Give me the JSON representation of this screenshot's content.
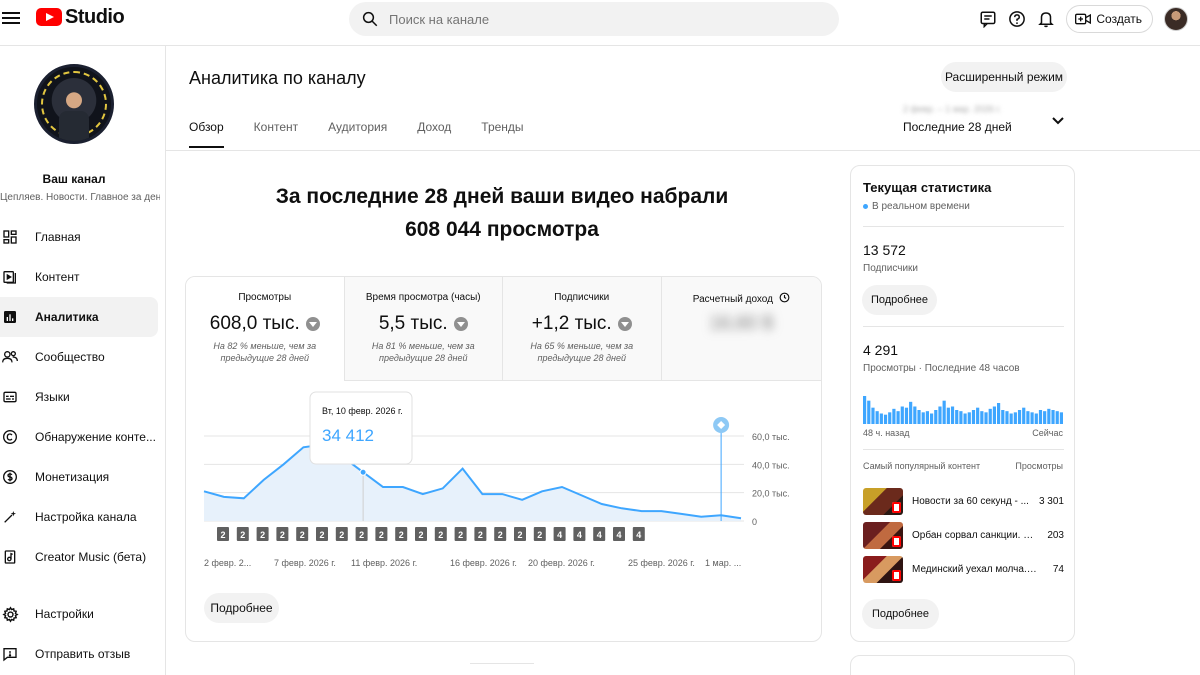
{
  "app": {
    "logo_text": "Studio",
    "search_placeholder": "Поиск на канале",
    "create_label": "Создать"
  },
  "sidebar": {
    "channel_name": "Ваш канал",
    "channel_desc": "Цепляев. Новости. Главное за день",
    "items": [
      {
        "label": "Главная",
        "icon": "dashboard-icon"
      },
      {
        "label": "Контент",
        "icon": "content-icon"
      },
      {
        "label": "Аналитика",
        "icon": "analytics-icon",
        "active": true
      },
      {
        "label": "Сообщество",
        "icon": "community-icon"
      },
      {
        "label": "Языки",
        "icon": "subtitles-icon"
      },
      {
        "label": "Обнаружение конте...",
        "icon": "copyright-icon"
      },
      {
        "label": "Монетизация",
        "icon": "monetization-icon"
      },
      {
        "label": "Настройка канала",
        "icon": "magic-wand-icon"
      },
      {
        "label": "Creator Music (бета)",
        "icon": "music-icon"
      }
    ],
    "bottom_items": [
      {
        "label": "Настройки",
        "icon": "settings-icon"
      },
      {
        "label": "Отправить отзыв",
        "icon": "feedback-icon"
      }
    ]
  },
  "main": {
    "title": "Аналитика по каналу",
    "advanced_label": "Расширенный режим",
    "tabs": [
      "Обзор",
      "Контент",
      "Аудитория",
      "Доход",
      "Тренды"
    ],
    "active_tab": "Обзор",
    "date_range": {
      "dates": "2 февр. – 1 мар. 2026 г.",
      "label": "Последние 28 дней"
    },
    "headline_line1": "За последние 28 дней ваши видео набрали",
    "headline_line2": "608 044 просмотра",
    "metrics": [
      {
        "label": "Просмотры",
        "value": "608,0 тыс.",
        "note": "На 82 % меньше, чем за предыдущие 28 дней",
        "trend": "down"
      },
      {
        "label": "Время просмотра (часы)",
        "value": "5,5 тыс.",
        "note": "На 81 % меньше, чем за предыдущие 28 дней",
        "trend": "down"
      },
      {
        "label": "Подписчики",
        "value": "+1,2 тыс.",
        "note": "На 65 % меньше, чем за предыдущие 28 дней",
        "trend": "down"
      },
      {
        "label": "Расчетный доход",
        "value": "16,60 $",
        "note": "",
        "trend": "hidden"
      }
    ],
    "more_label": "Подробнее"
  },
  "chart_data": {
    "type": "area",
    "title": "",
    "xlabel": "",
    "ylabel": "",
    "y_ticks": [
      "60,0 тыс.",
      "40,0 тыс.",
      "20,0 тыс.",
      "0"
    ],
    "ylim": [
      0,
      60000
    ],
    "x_tick_labels": [
      "2 февр. 2...",
      "7 февр. 2026 г.",
      "11 февр. 2026 г.",
      "16 февр. 2026 г.",
      "20 февр. 2026 г.",
      "25 февр. 2026 г.",
      "1 мар. ..."
    ],
    "x": [
      "2 февр.",
      "3 февр.",
      "4 февр.",
      "5 февр.",
      "6 февр.",
      "7 февр.",
      "8 февр.",
      "9 февр.",
      "10 февр.",
      "11 февр.",
      "12 февр.",
      "13 февр.",
      "14 февр.",
      "15 февр.",
      "16 февр.",
      "17 февр.",
      "18 февр.",
      "19 февр.",
      "20 февр.",
      "21 февр.",
      "22 февр.",
      "23 февр.",
      "24 февр.",
      "25 февр.",
      "26 февр.",
      "27 февр.",
      "28 февр.",
      "1 мар."
    ],
    "values": [
      21000,
      17000,
      16000,
      29000,
      40000,
      52000,
      54000,
      45000,
      34412,
      24000,
      24000,
      19000,
      23000,
      37000,
      19000,
      19000,
      15000,
      21000,
      24000,
      18000,
      12000,
      9000,
      7000,
      7000,
      5000,
      3000,
      4000,
      2000
    ],
    "markers": [
      "2",
      "2",
      "2",
      "2",
      "2",
      "2",
      "2",
      "2",
      "2",
      "2",
      "2",
      "2",
      "2",
      "2",
      "2",
      "2",
      "2",
      "4",
      "4",
      "4",
      "4",
      "4"
    ],
    "tooltip": {
      "date": "Вт, 10 февр. 2026 г.",
      "value": "34 412",
      "index": 8
    },
    "highlight_index": 26,
    "series_color": "#3ea6ff"
  },
  "realtime": {
    "title": "Текущая статистика",
    "subtitle": "В реальном времени",
    "subscribers_value": "13 572",
    "subscribers_label": "Подписчики",
    "more_label": "Подробнее",
    "views_value": "4 291",
    "views_label": "Просмотры · Последние 48 часов",
    "bars": [
      48,
      40,
      28,
      22,
      18,
      16,
      20,
      26,
      22,
      30,
      28,
      38,
      30,
      24,
      20,
      22,
      18,
      24,
      30,
      40,
      28,
      30,
      24,
      22,
      18,
      20,
      24,
      28,
      22,
      20,
      26,
      30,
      36,
      24,
      22,
      18,
      20,
      24,
      28,
      22,
      20,
      18,
      24,
      22,
      26,
      24,
      22,
      20
    ],
    "axis_left": "48 ч. назад",
    "axis_right": "Сейчас",
    "top_header_left": "Самый популярный контент",
    "top_header_right": "Просмотры",
    "top_content": [
      {
        "title": "Новости за 60 секунд - ...",
        "views": "3 301"
      },
      {
        "title": "Орбан сорвал санкции. А ...",
        "views": "203"
      },
      {
        "title": "Мединский уехал молча. В...",
        "views": "74"
      }
    ],
    "more_label_2": "Подробнее"
  }
}
